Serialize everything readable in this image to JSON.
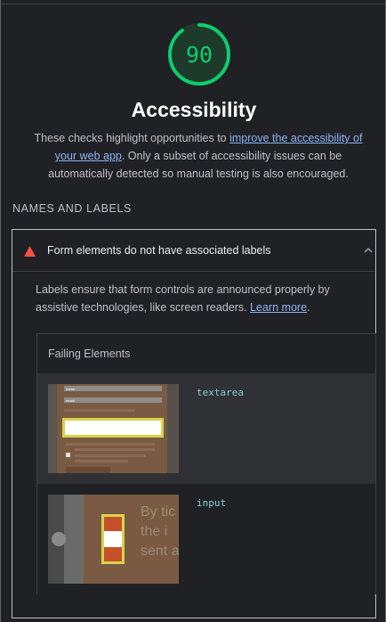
{
  "gauge": {
    "score": "90",
    "fraction": 0.9,
    "color": "#0cce6b"
  },
  "category": {
    "title": "Accessibility",
    "description": {
      "before": "These checks highlight opportunities to ",
      "link": "improve the accessibility of your web app",
      "after": ". Only a subset of accessibility issues can be automatically detected so manual testing is also encouraged."
    }
  },
  "group": {
    "title": "Names and labels"
  },
  "audit": {
    "status_icon": "fail-triangle-icon",
    "status_color": "#ff4e42",
    "title": "Form elements do not have associated labels",
    "expanded": true,
    "expand_icon": "chevron-up-icon",
    "description_before": "Labels ensure that form controls are announced properly by assistive technologies, like screen readers. ",
    "learn_more": "Learn more",
    "description_after": ".",
    "table": {
      "header": "Failing Elements",
      "rows": [
        {
          "node": "textarea",
          "thumbnail": "textarea-screenshot"
        },
        {
          "node": "input",
          "thumbnail": "input-screenshot"
        }
      ]
    }
  },
  "thumbnail_text": {
    "field_1": "name",
    "field_2": "email",
    "overlay": "By tic the i sent a"
  }
}
